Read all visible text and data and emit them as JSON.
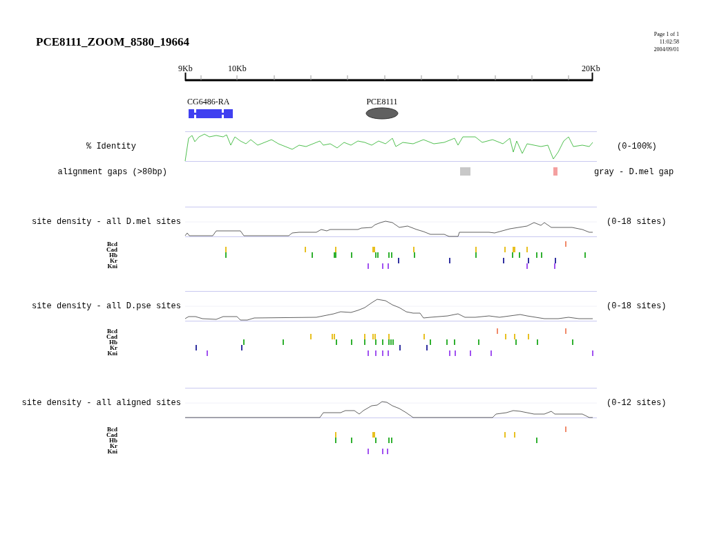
{
  "header": {
    "title": "PCE8111_ZOOM_8580_19664",
    "page_info": [
      "Page 1 of 1",
      "11:02:58",
      "2004/09/01"
    ]
  },
  "ruler": {
    "labels": [
      "9Kb",
      "10Kb",
      "20Kb"
    ]
  },
  "features": [
    {
      "kind": "gene",
      "label": "CG6486-RA"
    },
    {
      "kind": "element",
      "label": "PCE8111"
    }
  ],
  "identity_track": {
    "label": "% Identity",
    "range": "(0-100%)"
  },
  "alignment_gaps": {
    "label": "alignment gaps (>80bp)",
    "legend": "gray - D.mel gap",
    "gaps": [
      {
        "color": "#c8c8c8"
      },
      {
        "color": "#f4a0a0"
      }
    ]
  },
  "density_tracks": [
    {
      "label": "site density - all D.mel sites",
      "range": "(0-18 sites)",
      "factors": [
        {
          "name": "Bcd",
          "color": "#f08a6a"
        },
        {
          "name": "Cad",
          "color": "#e8c020"
        },
        {
          "name": "Hb",
          "color": "#30b030"
        },
        {
          "name": "Kr",
          "color": "#3030a0"
        },
        {
          "name": "Kni",
          "color": "#a050f0"
        }
      ]
    },
    {
      "label": "site density - all D.pse sites",
      "range": "(0-18 sites)",
      "factors": [
        {
          "name": "Bcd",
          "color": "#f08a6a"
        },
        {
          "name": "Cad",
          "color": "#e8c020"
        },
        {
          "name": "Hb",
          "color": "#30b030"
        },
        {
          "name": "Kr",
          "color": "#3030a0"
        },
        {
          "name": "Kni",
          "color": "#a050f0"
        }
      ]
    },
    {
      "label": "site density - all aligned sites",
      "range": "(0-12 sites)",
      "factors": [
        {
          "name": "Bcd",
          "color": "#f08a6a"
        },
        {
          "name": "Cad",
          "color": "#e8c020"
        },
        {
          "name": "Hb",
          "color": "#30b030"
        },
        {
          "name": "Kr"
        },
        {
          "name": "Kni",
          "color": "#a050f0"
        }
      ]
    }
  ]
}
